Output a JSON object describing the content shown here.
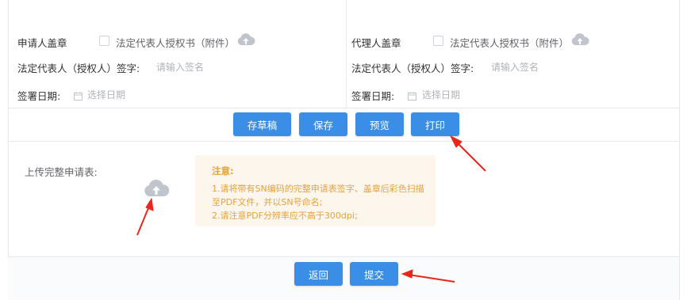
{
  "applicant": {
    "seal_label": "申请人盖章",
    "attachment_option": "法定代表人授权书（附件）",
    "signature_label": "法定代表人（授权人）签字:",
    "signature_placeholder": "请输入签名",
    "date_label": "签署日期:",
    "date_placeholder": "选择日期"
  },
  "agent": {
    "seal_label": "代理人盖章",
    "attachment_option": "法定代表人授权书（附件）",
    "signature_label": "法定代表人（授权人）签字:",
    "signature_placeholder": "请输入签名",
    "date_label": "签署日期:",
    "date_placeholder": "选择日期"
  },
  "actions": {
    "save_draft": "存草稿",
    "save": "保存",
    "preview": "预览",
    "print": "打印"
  },
  "upload": {
    "label": "上传完整申请表:"
  },
  "notice": {
    "title": "注意:",
    "line1": "1.请将带有SN编码的完整申请表签字、盖章后彩色扫描",
    "line2": "至PDF文件，并以SN号命名;",
    "line3": "2.请注意PDF分辨率应不高于300dpi;"
  },
  "footer": {
    "back": "返回",
    "submit": "提交"
  },
  "colors": {
    "primary": "#3a8ee6",
    "warning_text": "#e6a23c",
    "warning_bg": "#fdf6ec",
    "arrow": "#e8261c"
  }
}
